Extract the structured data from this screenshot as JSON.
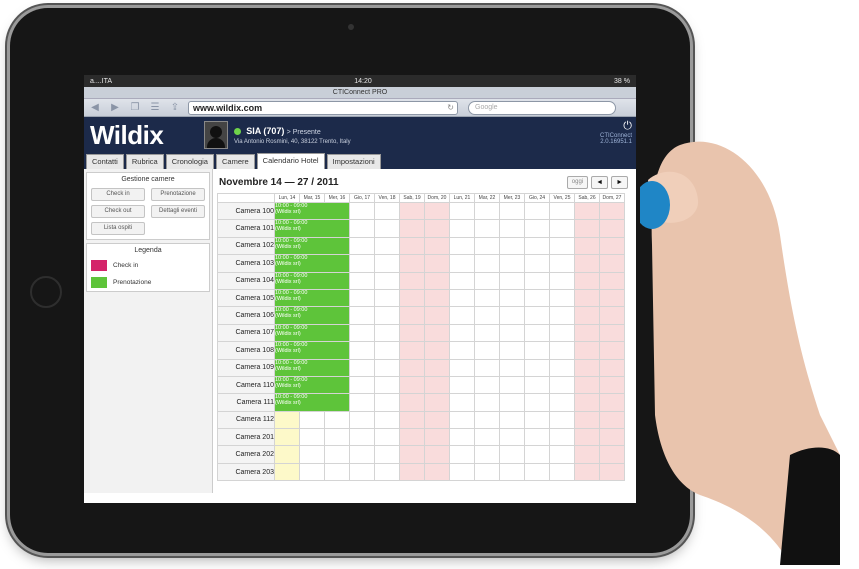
{
  "statusbar": {
    "carrier": "a....ITA",
    "time": "14:20",
    "battery": "38 %"
  },
  "browser": {
    "title": "CTIConnect PRO",
    "url": "www.wildix.com",
    "search_placeholder": "Google"
  },
  "app": {
    "logo": "Wildix",
    "user": {
      "name": "SIA (707)",
      "presence": "> Presente",
      "address": "Via Antonio Rosmini, 40, 38122 Trento, Italy"
    },
    "product": "CTIConnect",
    "version": "2.0.16951.1"
  },
  "tabs": [
    {
      "label": "Contatti"
    },
    {
      "label": "Rubrica"
    },
    {
      "label": "Cronologia"
    },
    {
      "label": "Camere"
    },
    {
      "label": "Calendario Hotel",
      "active": true
    },
    {
      "label": "Impostazioni"
    }
  ],
  "sidebar": {
    "gestione_title": "Gestione camere",
    "buttons": [
      "Check in",
      "Prenotazione",
      "Check out",
      "Dettagli eventi",
      "Lista ospiti"
    ],
    "legenda_title": "Legenda",
    "legend": [
      {
        "label": "Check in",
        "color": "#d4246a"
      },
      {
        "label": "Prenotazione",
        "color": "#5ec43a"
      }
    ]
  },
  "calendar": {
    "title": "Novembre 14 — 27 / 2011",
    "today_label": "oggi",
    "prev": "◄",
    "next": "►",
    "days": [
      "Lun, 14",
      "Mar, 15",
      "Mer, 16",
      "Gio, 17",
      "Ven, 18",
      "Sab, 19",
      "Dom, 20",
      "Lun, 21",
      "Mar, 22",
      "Mer, 23",
      "Gio, 24",
      "Ven, 25",
      "Sab, 26",
      "Dom, 27"
    ],
    "weekend_indices": [
      5,
      6,
      12,
      13
    ],
    "today_index": 0,
    "rooms": [
      "Camera 100",
      "Camera 101",
      "Camera 102",
      "Camera 103",
      "Camera 104",
      "Camera 105",
      "Camera 106",
      "Camera 107",
      "Camera 108",
      "Camera 109",
      "Camera 110",
      "Camera 111",
      "Camera 112",
      "Camera 201",
      "Camera 202",
      "Camera 203"
    ],
    "booking": {
      "rooms_count": 12,
      "span_days": 3,
      "line1": "10:00 - 09:00",
      "line2": "(Wildix srl)"
    }
  }
}
